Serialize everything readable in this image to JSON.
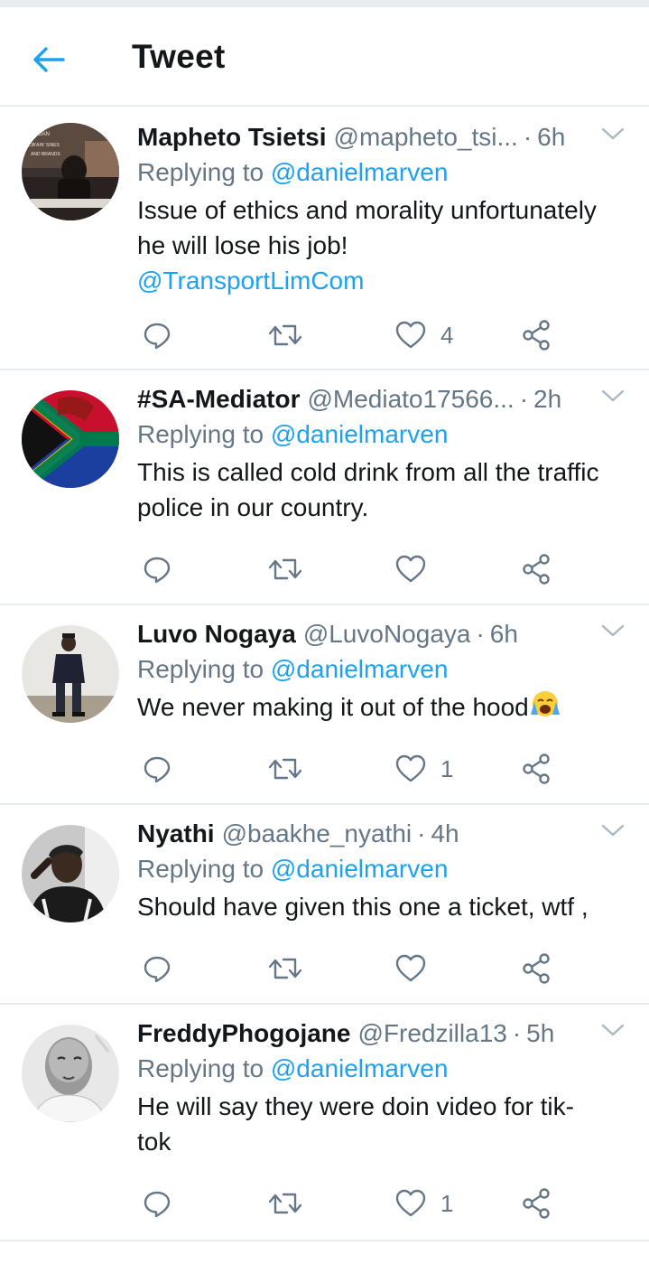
{
  "header": {
    "title": "Tweet"
  },
  "colors": {
    "accent": "#1da1f2",
    "muted": "#657786",
    "text": "#14171a",
    "divider": "#e6ecf0"
  },
  "tweets": [
    {
      "name": "Mapheto Tsietsi",
      "handle": "@mapheto_tsi...",
      "time": "6h",
      "replying_prefix": "Replying to",
      "replying_to": "@danielmarven",
      "text": "Issue of ethics and morality unfortunately he will lose his job!",
      "link": "@TransportLimCom",
      "likes": "4",
      "avatar_text": "IF W DAN  OB'AIN' SINES AND BRANDS"
    },
    {
      "name": "#SA-Mediator",
      "handle": "@Mediato17566...",
      "time": "2h",
      "replying_prefix": "Replying to",
      "replying_to": "@danielmarven",
      "text": "This is called cold drink from all the traffic police in our country.",
      "likes": ""
    },
    {
      "name": "Luvo Nogaya",
      "handle": "@LuvoNogaya",
      "time": "6h",
      "replying_prefix": "Replying to",
      "replying_to": "@danielmarven",
      "text": "We never making it out of the hood",
      "emoji": "crying-face-emoji",
      "likes": "1"
    },
    {
      "name": "Nyathi",
      "handle": "@baakhe_nyathi",
      "time": "4h",
      "replying_prefix": "Replying to",
      "replying_to": "@danielmarven",
      "text": "Should have given this one a ticket, wtf ,",
      "likes": ""
    },
    {
      "name": "FreddyPhogojane",
      "handle": "@Fredzilla13",
      "time": "5h",
      "replying_prefix": "Replying to",
      "replying_to": "@danielmarven",
      "text": "He will say they were doin video for tik-tok",
      "likes": "1"
    }
  ],
  "icons": [
    "back-arrow-icon",
    "chevron-down-icon",
    "reply-icon",
    "retweet-icon",
    "like-icon",
    "share-icon"
  ]
}
